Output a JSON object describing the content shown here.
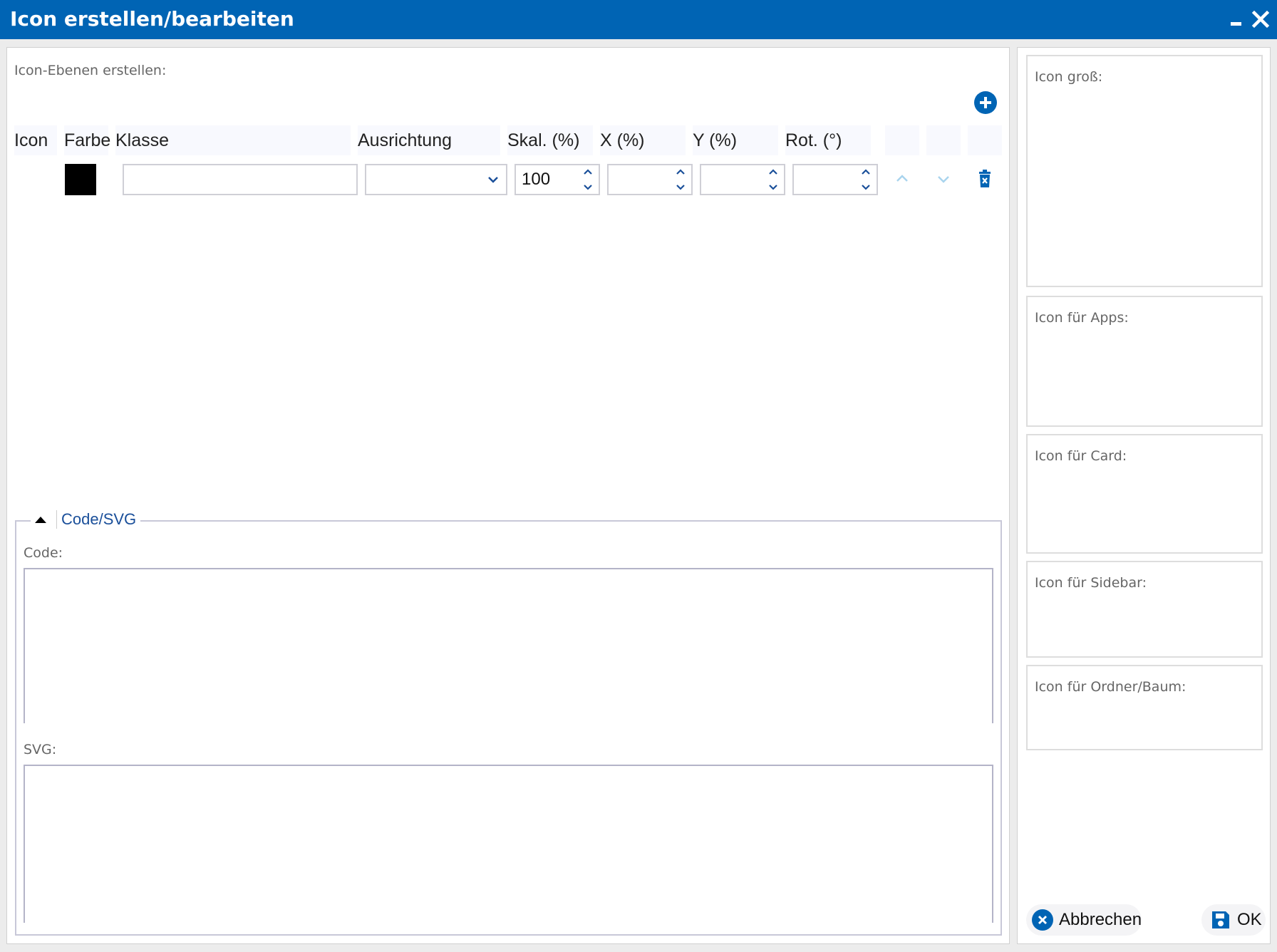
{
  "window": {
    "title": "Icon erstellen/bearbeiten"
  },
  "layers": {
    "section_label": "Icon-Ebenen erstellen:",
    "columns": {
      "icon": "Icon",
      "farbe": "Farbe",
      "klasse": "Klasse",
      "ausrichtung": "Ausrichtung",
      "skal": "Skal. (%)",
      "x": "X (%)",
      "y": "Y (%)",
      "rot": "Rot. (°)"
    },
    "row": {
      "color": "#000000",
      "klasse": "",
      "ausrichtung": "",
      "skal": "100",
      "x": "",
      "y": "",
      "rot": ""
    }
  },
  "code_svg": {
    "legend": "Code/SVG",
    "code_label": "Code:",
    "svg_label": "SVG:",
    "code_value": "",
    "svg_value": ""
  },
  "previews": [
    {
      "label": "Icon groß:"
    },
    {
      "label": "Icon für Apps:"
    },
    {
      "label": "Icon für Card:"
    },
    {
      "label": "Icon für Sidebar:"
    },
    {
      "label": "Icon für Ordner/Baum:"
    }
  ],
  "buttons": {
    "cancel": "Abbrechen",
    "ok": "OK"
  },
  "colors": {
    "accent": "#0064b4",
    "header_bg": "#f8f9fe",
    "legend_text": "#1a4f9a",
    "disabled_arrow": "#a9d4ee"
  },
  "icons": [
    "minimize-icon",
    "close-icon",
    "add-layer-icon",
    "chevron-down-icon",
    "spinner-icon",
    "move-up-icon",
    "move-down-icon",
    "delete-icon",
    "collapse-triangle-icon",
    "cancel-icon",
    "save-icon"
  ]
}
